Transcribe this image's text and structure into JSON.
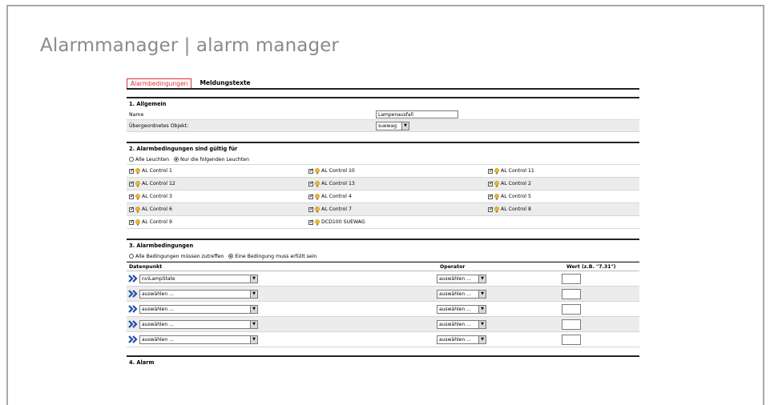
{
  "page": {
    "title": "Alarmmanager | alarm manager"
  },
  "tabs": [
    {
      "label": "Alarmbedingungen",
      "active": true
    },
    {
      "label": "Meldungstexte",
      "active": false
    }
  ],
  "general": {
    "title": "1. Allgemein",
    "name_label": "Name",
    "name_value": "Lampenausfall",
    "parent_label": "Übergeordnetes Objekt:",
    "parent_value": "suewag"
  },
  "lamps": {
    "title": "2. Alarmbedingungen sind gültig für",
    "radio_all": "Alle Leuchten",
    "radio_selected": "Nur die folgenden Leuchten",
    "selected_option": "radio_selected",
    "rows": [
      [
        "AL Control 1",
        "AL Control 10",
        "AL Control 11"
      ],
      [
        "AL Control 12",
        "AL Control 13",
        "AL Control 2"
      ],
      [
        "AL Control 3",
        "AL Control 4",
        "AL Control 5"
      ],
      [
        "AL Control 6",
        "AL Control 7",
        "AL Control 8"
      ],
      [
        "AL Control 9",
        "DCD100 SUEWAG",
        ""
      ]
    ]
  },
  "conditions": {
    "title": "3. Alarmbedingungen",
    "radio_all": "Alle Bedingungen müssen zutreffen",
    "radio_one": "Eine Bedingung muss erfüllt sein",
    "selected_option": "radio_one",
    "headers": {
      "datapoint": "Datenpunkt",
      "operator": "Operator",
      "value": "Wert (z.B. \"7.31\")"
    },
    "rows": [
      {
        "datapoint": "nviLampState",
        "operator": "auswählen ...",
        "value": ""
      },
      {
        "datapoint": "auswählen ...",
        "operator": "auswählen ...",
        "value": ""
      },
      {
        "datapoint": "auswählen ...",
        "operator": "auswählen ...",
        "value": ""
      },
      {
        "datapoint": "auswählen ...",
        "operator": "auswählen ...",
        "value": ""
      },
      {
        "datapoint": "auswählen ...",
        "operator": "auswählen ...",
        "value": ""
      }
    ]
  },
  "alarm": {
    "title": "4. Alarm"
  },
  "colors": {
    "active_tab": "#e03030",
    "chevron": "#1e4fa8",
    "bulb": "#f2b824",
    "title_gray": "#8a8a8a"
  },
  "icons": {
    "chevron": "double-chevron-right-icon",
    "bulb": "lightbulb-icon",
    "dropdown": "dropdown-arrow-icon"
  }
}
